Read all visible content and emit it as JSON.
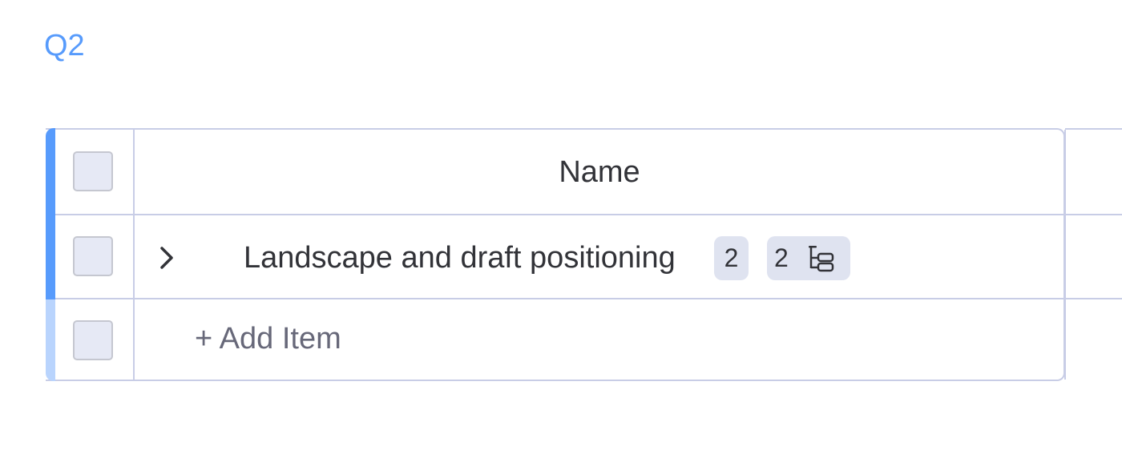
{
  "group": {
    "title": "Q2",
    "color": "#579bfc"
  },
  "table": {
    "columns": {
      "name_header": "Name"
    },
    "rows": [
      {
        "name": "Landscape and draft positioning",
        "updates_count": "2",
        "subitems_count": "2",
        "expand_icon": "chevron-right-icon",
        "subitems_icon": "subitems-tree-icon"
      }
    ],
    "add_item_label": "+ Add Item"
  }
}
